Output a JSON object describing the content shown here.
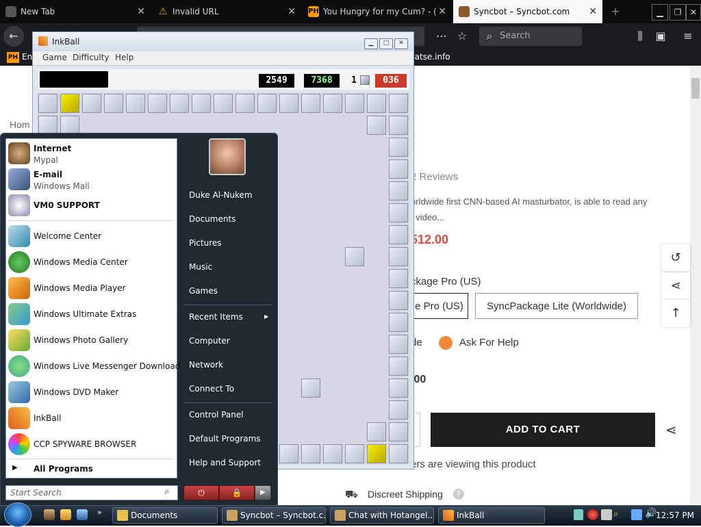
{
  "browser": {
    "tabs": [
      {
        "title": "New Tab",
        "icon_color": "#666"
      },
      {
        "title": "Invalid URL",
        "icon_color": "#d6a100"
      },
      {
        "title": "You Hungry for my Cum? - (",
        "icon_color": "#ff9900",
        "icon_text": "PH"
      },
      {
        "title": "Syncbot – Syncbot.com",
        "icon_color": "#8a5a2a"
      }
    ],
    "new_tab_label": "+",
    "search_placeholder": "Search",
    "bookmarks": [
      {
        "label": "En",
        "icon_text": "PH"
      },
      {
        "label": "batse.info"
      }
    ]
  },
  "page": {
    "breadcrumb": "Hom",
    "reviews": "2 Reviews",
    "description_line1": "orldwide first CNN-based AI masturbator, is able to read any",
    "description_line2": "t video...",
    "price": "512.00",
    "option_label": "ckage Pro (US)",
    "variant_pro": "e Pro (US)",
    "variant_lite": "SyncPackage Lite (Worldwide)",
    "guide_link": "de",
    "help_link": "Ask For Help",
    "subtotal": ".00",
    "add_to_cart": "ADD TO CART",
    "viewers": "ers are viewing this product",
    "shipping": "Discreet Shipping",
    "colors": {
      "price": "#e04a3f",
      "cart_bg": "#1e1e1e"
    }
  },
  "inkball": {
    "title": "InkBall",
    "menu": [
      "Game",
      "Difficulty",
      "Help"
    ],
    "score1": "2549",
    "score2": "7368",
    "balls_count": "1",
    "timer": "036"
  },
  "startmenu": {
    "pinned": [
      {
        "label": "Internet",
        "sub": "Mypal"
      },
      {
        "label": "E-mail",
        "sub": "Windows Mail"
      },
      {
        "label": "VM0 SUPPORT"
      }
    ],
    "recent": [
      "Welcome Center",
      "Windows Media Center",
      "Windows Media Player",
      "Windows Ultimate Extras",
      "Windows Photo Gallery",
      "Windows Live Messenger Download",
      "Windows DVD Maker",
      "InkBall",
      "CCP SPYWARE BROWSER"
    ],
    "all_programs": "All Programs",
    "search_placeholder": "Start Search",
    "right": {
      "user": "Duke Al-Nukem",
      "documents": "Documents",
      "pictures": "Pictures",
      "music": "Music",
      "games": "Games",
      "recent_items": "Recent Items",
      "computer": "Computer",
      "network": "Network",
      "connect_to": "Connect To",
      "control_panel": "Control Panel",
      "default_programs": "Default Programs",
      "help_support": "Help and Support"
    }
  },
  "taskbar": {
    "buttons": [
      {
        "label": "Documents"
      },
      {
        "label": "Syncbot – Syncbot.c..."
      },
      {
        "label": "Chat with Hotangel..."
      },
      {
        "label": "InkBall"
      }
    ],
    "clock": "12:57 PM"
  }
}
